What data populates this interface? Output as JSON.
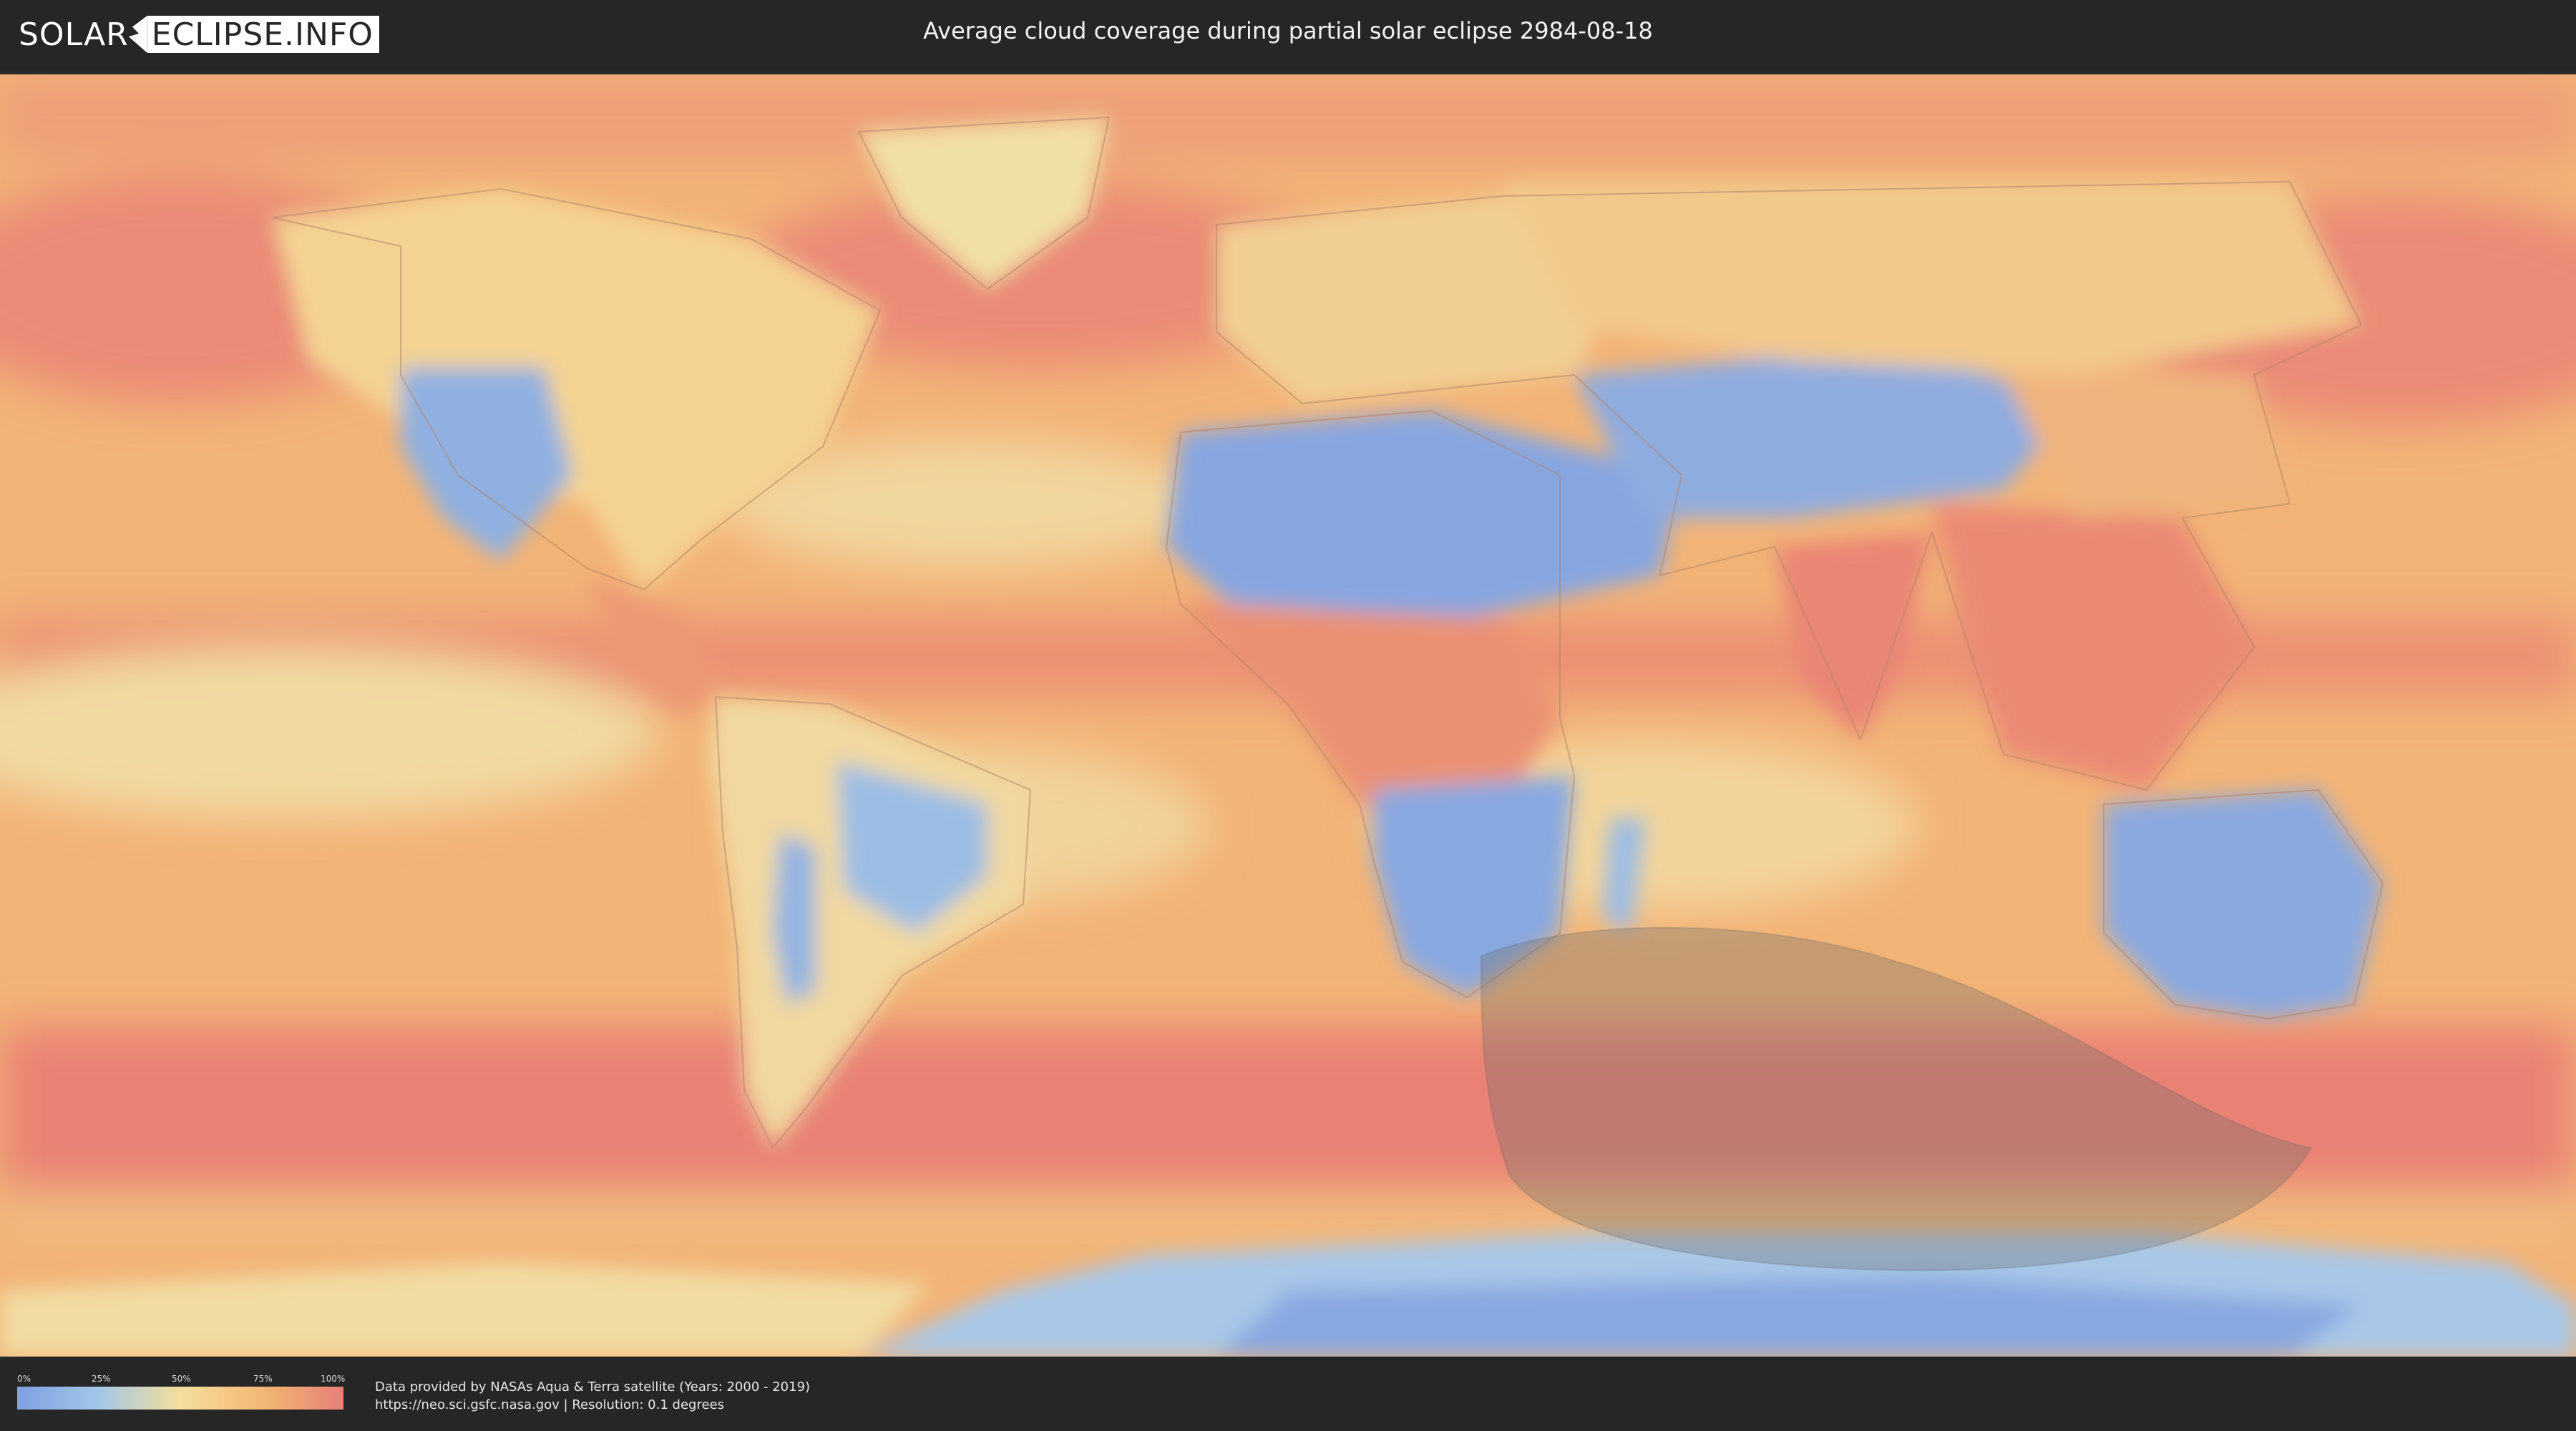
{
  "header": {
    "logo_left": "SOLAR",
    "logo_right": "ECLIPSE.INFO",
    "title": "Average cloud coverage during partial solar eclipse 2984-08-18"
  },
  "map": {
    "colors": {
      "clear": "#7fa0e2",
      "low": "#a3c6e6",
      "mid": "#f4df9c",
      "high": "#f3b873",
      "overcast": "#e87f78",
      "eclipse_zone": "#6b6b6b"
    }
  },
  "legend": {
    "ticks": [
      "0%",
      "25%",
      "50%",
      "75%",
      "100%"
    ]
  },
  "footer": {
    "credit_line1": "Data provided by NASAs Aqua & Terra satellite (Years: 2000 - 2019)",
    "credit_line2": "https://neo.sci.gsfc.nasa.gov | Resolution: 0.1 degrees"
  }
}
